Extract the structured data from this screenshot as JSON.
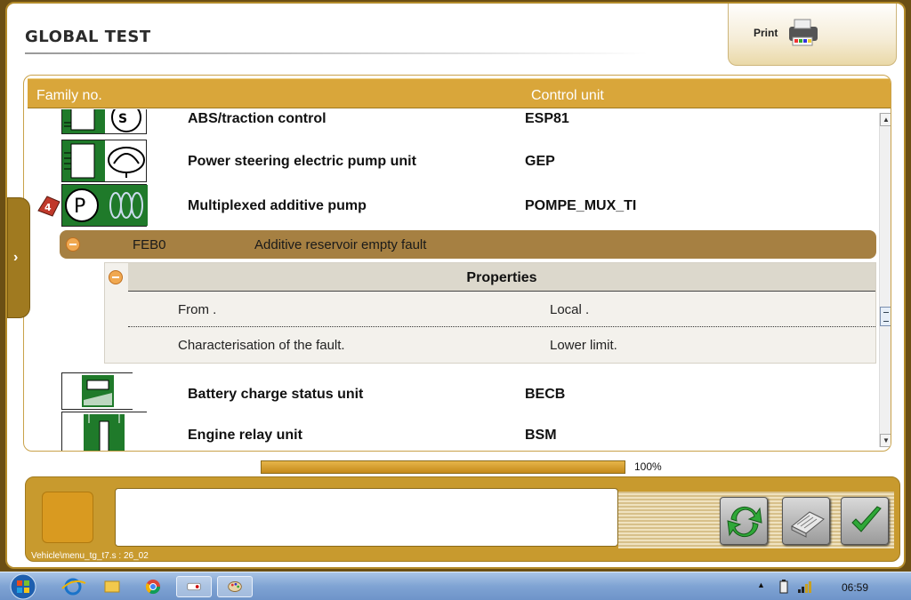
{
  "header": {
    "title": "GLOBAL TEST",
    "print_label": "Print"
  },
  "table": {
    "col_family": "Family no.",
    "col_control": "Control unit",
    "rows": [
      {
        "name": "ABS/traction control",
        "code": "ESP81"
      },
      {
        "name": "Power steering electric pump unit",
        "code": "GEP"
      },
      {
        "name": "Multiplexed additive pump",
        "code": "POMPE_MUX_TI"
      },
      {
        "name": "Battery charge status unit",
        "code": "BECB"
      },
      {
        "name": "Engine relay unit",
        "code": "BSM"
      }
    ],
    "fault": {
      "code": "FEB0",
      "description": "Additive reservoir empty fault"
    },
    "properties": {
      "title": "Properties",
      "items": [
        {
          "key": "From .",
          "value": "Local ."
        },
        {
          "key": "Characterisation of the fault.",
          "value": "Lower limit."
        }
      ]
    }
  },
  "progress": {
    "value": 1.0,
    "label": "100%"
  },
  "footer": {
    "status_path": "Vehicle\\menu_tg_t7.s : 26_02"
  },
  "taskbar": {
    "clock": "06:59"
  },
  "colors": {
    "accent": "#d9a63a",
    "fault_bar": "#a68042",
    "ecu_green": "#1f7a2a"
  }
}
